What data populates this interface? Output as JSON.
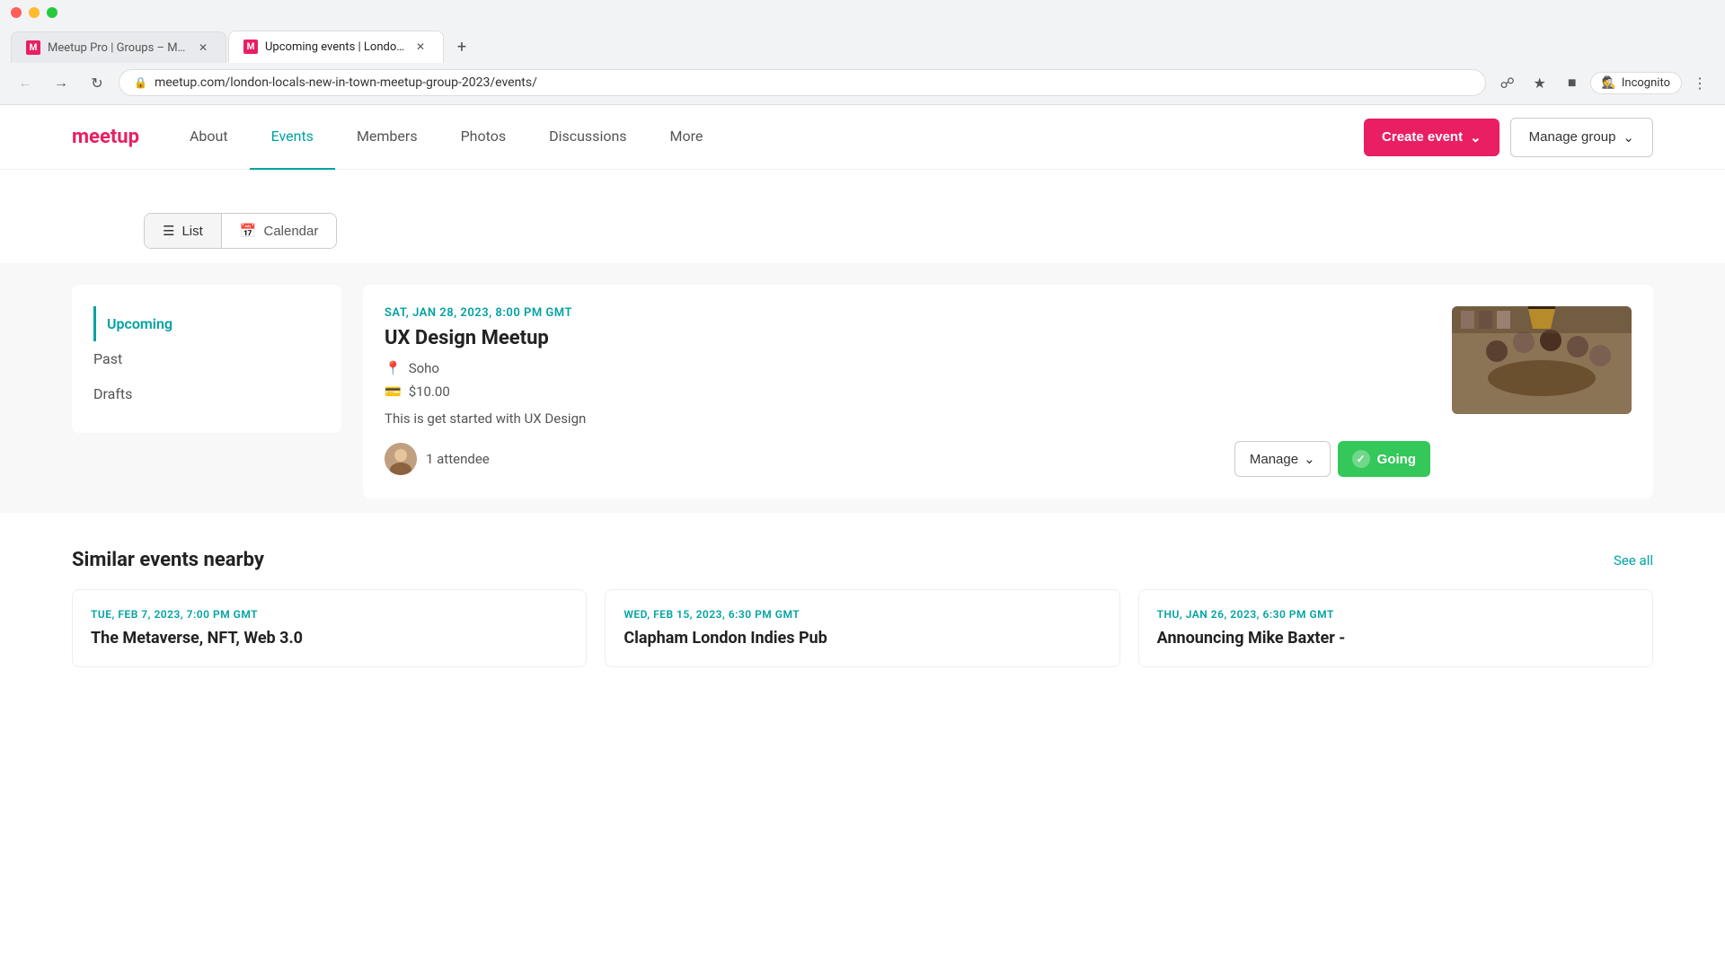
{
  "browser": {
    "tabs": [
      {
        "id": "tab1",
        "title": "Meetup Pro | Groups – Meetup",
        "favicon": "M",
        "active": false
      },
      {
        "id": "tab2",
        "title": "Upcoming events | London Local...",
        "favicon": "M",
        "active": true
      }
    ],
    "address": "meetup.com/london-locals-new-in-town-meetup-group-2023/events/",
    "incognito_label": "Incognito"
  },
  "nav": {
    "links": [
      {
        "id": "about",
        "label": "About",
        "active": false
      },
      {
        "id": "events",
        "label": "Events",
        "active": true
      },
      {
        "id": "members",
        "label": "Members",
        "active": false
      },
      {
        "id": "photos",
        "label": "Photos",
        "active": false
      },
      {
        "id": "discussions",
        "label": "Discussions",
        "active": false
      },
      {
        "id": "more",
        "label": "More",
        "active": false
      }
    ],
    "create_event_label": "Create event",
    "manage_group_label": "Manage group"
  },
  "view_toggle": {
    "list_label": "List",
    "calendar_label": "Calendar"
  },
  "sidebar": {
    "items": [
      {
        "id": "upcoming",
        "label": "Upcoming",
        "active": true
      },
      {
        "id": "past",
        "label": "Past",
        "active": false
      },
      {
        "id": "drafts",
        "label": "Drafts",
        "active": false
      }
    ]
  },
  "event": {
    "date": "SAT, JAN 28, 2023, 8:00 PM GMT",
    "title": "UX Design Meetup",
    "location": "Soho",
    "price": "$10.00",
    "description": "This is get started with UX Design",
    "attendee_count": "1 attendee",
    "manage_label": "Manage",
    "going_label": "Going"
  },
  "similar_events": {
    "section_title": "Similar events nearby",
    "see_all_label": "See all",
    "cards": [
      {
        "date": "TUE, FEB 7, 2023, 7:00 PM GMT",
        "title": "The Metaverse, NFT, Web 3.0"
      },
      {
        "date": "WED, FEB 15, 2023, 6:30 PM GMT",
        "title": "Clapham London Indies Pub"
      },
      {
        "date": "THU, JAN 26, 2023, 6:30 PM GMT",
        "title": "Announcing Mike Baxter -"
      }
    ]
  }
}
